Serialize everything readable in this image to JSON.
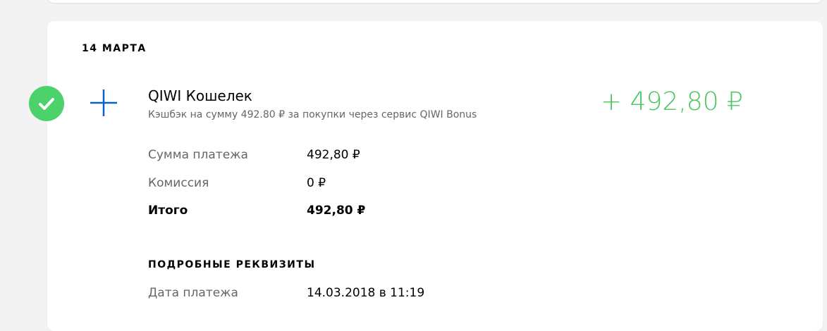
{
  "date_header": "14 МАРТА",
  "transaction": {
    "status": "success",
    "provider_name": "QIWI Кошелек",
    "description": "Кэшбэк на сумму 492.80 ₽ за покупки через сервис QIWI Bonus",
    "amount": "+ 492,80 ₽",
    "amount_color": "#4bc562",
    "status_color": "#4bd26b",
    "icon_color": "#0a62c5"
  },
  "summary": [
    {
      "label": "Сумма платежа",
      "value": "492,80 ₽"
    },
    {
      "label": "Комиссия",
      "value": "0 ₽"
    },
    {
      "label": "Итого",
      "value": "492,80 ₽"
    }
  ],
  "details": {
    "title": "ПОДРОБНЫЕ РЕКВИЗИТЫ",
    "rows": [
      {
        "label": "Дата платежа",
        "value": "14.03.2018 в 11:19"
      }
    ]
  }
}
